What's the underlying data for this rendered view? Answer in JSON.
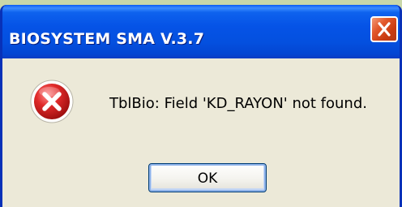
{
  "window": {
    "title": "BIOSYSTEM SMA V.3.7"
  },
  "dialog": {
    "icon": "error-icon",
    "message": "TblBio: Field 'KD_RAYON' not found.",
    "ok_label": "OK"
  },
  "colors": {
    "titlebar": "#0553e6",
    "client_background": "#ece9d8",
    "close_button": "#e2582a",
    "error_icon": "#d32222"
  }
}
